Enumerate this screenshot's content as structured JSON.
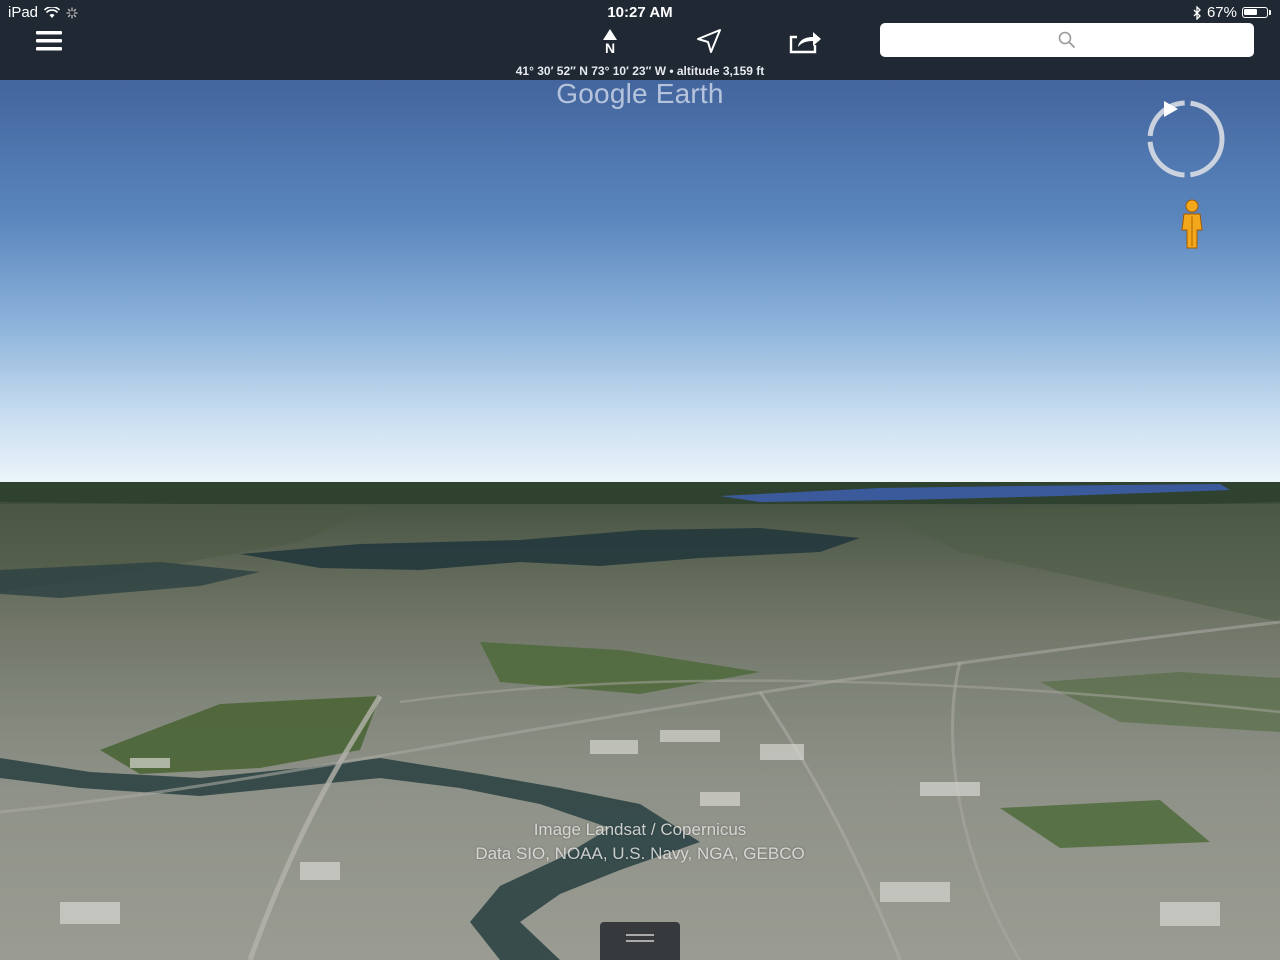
{
  "status_bar": {
    "device": "iPad",
    "time": "10:27 AM",
    "battery_percent_label": "67%",
    "battery_level": 0.67,
    "icons": [
      "wifi-icon",
      "activity-spinner-icon",
      "bluetooth-icon",
      "battery-icon"
    ]
  },
  "toolbar": {
    "menu_icon": "hamburger-menu-icon",
    "north_label": "N",
    "locate_icon": "location-arrow-icon",
    "share_icon": "share-icon",
    "search_placeholder": "",
    "search_icon": "search-icon"
  },
  "map": {
    "coordinates": "41° 30′ 52″ N  73° 10′ 23″ W • altitude 3,159 ft",
    "brand": "Google Earth",
    "attribution": [
      "Image Landsat / Copernicus",
      "Data SIO, NOAA, U.S. Navy, NGA, GEBCO"
    ],
    "compass_icon": "compass-ring-icon",
    "pegman_icon": "street-view-pegman-icon"
  },
  "colors": {
    "toolbar_bg": "#1f2833",
    "sky_top": "#3a5a91",
    "horizon": "#ecf5fb",
    "water": "#2a4a58",
    "pegman": "#f3a81c"
  }
}
